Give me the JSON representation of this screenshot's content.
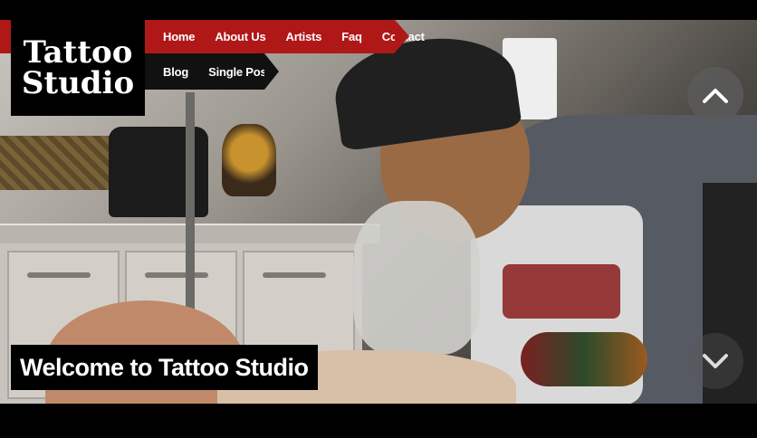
{
  "logo": {
    "text": "Tattoo\nStudio"
  },
  "nav": {
    "primary": [
      {
        "label": "Home"
      },
      {
        "label": "About Us"
      },
      {
        "label": "Artists"
      },
      {
        "label": "Faq"
      },
      {
        "label": "Contact"
      }
    ],
    "secondary": [
      {
        "label": "Blog"
      },
      {
        "label": "Single Post"
      }
    ]
  },
  "hero": {
    "caption": "Welcome to Tattoo Studio",
    "prev_icon": "chevron-up-icon",
    "next_icon": "chevron-down-icon"
  },
  "colors": {
    "accent": "#b01818",
    "background": "#000000"
  }
}
